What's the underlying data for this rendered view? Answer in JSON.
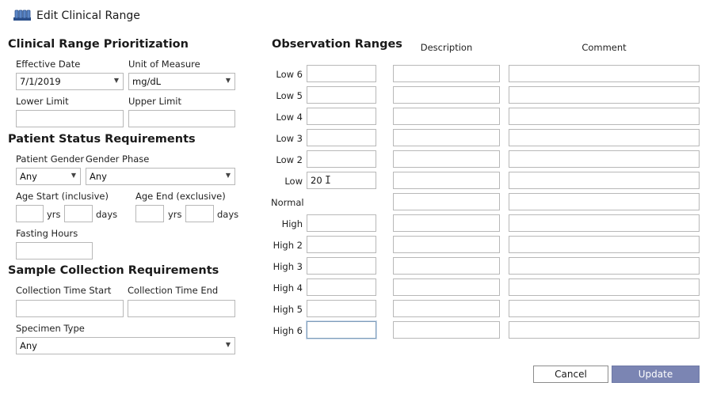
{
  "window": {
    "title": "Edit Clinical Range",
    "icon": "test-tubes-icon"
  },
  "prioritization": {
    "heading": "Clinical Range Prioritization",
    "effective_date_label": "Effective Date",
    "effective_date_value": "7/1/2019",
    "unit_label": "Unit of Measure",
    "unit_value": "mg/dL",
    "lower_limit_label": "Lower Limit",
    "lower_limit_value": "",
    "upper_limit_label": "Upper Limit",
    "upper_limit_value": ""
  },
  "patient_status": {
    "heading": "Patient Status Requirements",
    "gender_label": "Patient Gender",
    "gender_value": "Any",
    "phase_label": "Gender Phase",
    "phase_value": "Any",
    "age_start_label": "Age Start (inclusive)",
    "age_end_label": "Age End (exclusive)",
    "yrs": "yrs",
    "days": "days",
    "age_start_yrs": "",
    "age_start_days": "",
    "age_end_yrs": "",
    "age_end_days": "",
    "fasting_label": "Fasting Hours",
    "fasting_value": ""
  },
  "sample_collection": {
    "heading": "Sample Collection Requirements",
    "time_start_label": "Collection Time Start",
    "time_end_label": "Collection Time End",
    "time_start_value": "",
    "time_end_value": "",
    "specimen_label": "Specimen Type",
    "specimen_value": "Any"
  },
  "observation": {
    "heading": "Observation Ranges",
    "description_header": "Description",
    "comment_header": "Comment",
    "rows": [
      {
        "label": "Low 6",
        "value": ""
      },
      {
        "label": "Low 5",
        "value": ""
      },
      {
        "label": "Low 4",
        "value": ""
      },
      {
        "label": "Low 3",
        "value": ""
      },
      {
        "label": "Low 2",
        "value": ""
      },
      {
        "label": "Low",
        "value": "20"
      },
      {
        "label": "Normal",
        "value": ""
      },
      {
        "label": "High",
        "value": ""
      },
      {
        "label": "High 2",
        "value": ""
      },
      {
        "label": "High 3",
        "value": ""
      },
      {
        "label": "High 4",
        "value": ""
      },
      {
        "label": "High 5",
        "value": ""
      },
      {
        "label": "High 6",
        "value": ""
      }
    ]
  },
  "buttons": {
    "cancel": "Cancel",
    "update": "Update"
  }
}
